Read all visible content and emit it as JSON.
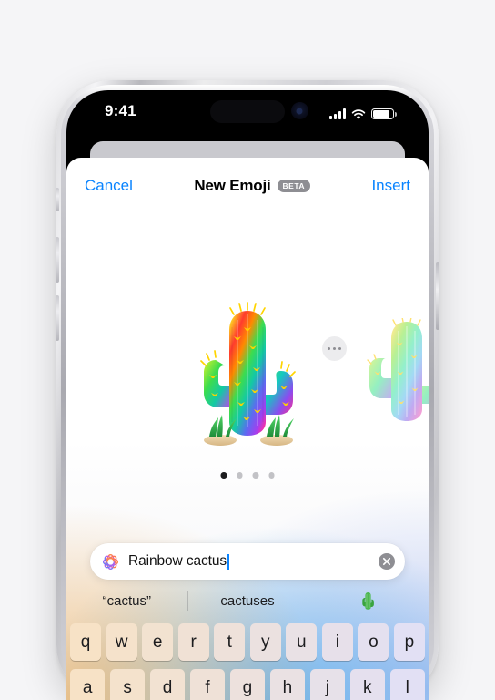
{
  "page": {
    "background_color": "#f5f5f7"
  },
  "device": {
    "name": "iphone-frame",
    "frame_color": "#d4d4d9",
    "buttons": [
      "mute-switch",
      "volume-up",
      "volume-down",
      "power-button"
    ]
  },
  "status_bar": {
    "time": "9:41",
    "cellular_icon": "signal-bars-icon",
    "wifi_icon": "wifi-icon",
    "battery_icon": "battery-icon",
    "dynamic_island": "dynamic-island",
    "front_camera": "front-camera"
  },
  "sheet": {
    "nav": {
      "cancel_label": "Cancel",
      "title": "New Emoji",
      "beta_label": "BETA",
      "insert_label": "Insert",
      "accent_color": "#0a84ff"
    },
    "canvas": {
      "more_button_icon": "ellipsis-icon",
      "main_emoji_name": "rainbow-cactus-emoji",
      "next_emoji_name": "pastel-cactus-emoji",
      "page_dots": {
        "count": 4,
        "active_index": 0
      }
    },
    "prompt": {
      "ai_icon": "apple-intelligence-icon",
      "value": "Rainbow cactus",
      "placeholder": "Describe an emoji",
      "clear_icon": "clear-circle-icon"
    },
    "predictions": [
      {
        "label": "“cactus”",
        "type": "text"
      },
      {
        "label": "cactuses",
        "type": "text"
      },
      {
        "label": "cactus-emoji",
        "type": "emoji"
      }
    ],
    "keyboard": {
      "row1": [
        "q",
        "w",
        "e",
        "r",
        "t",
        "y",
        "u",
        "i",
        "o",
        "p"
      ],
      "row2": [
        "a",
        "s",
        "d",
        "f",
        "g",
        "h",
        "j",
        "k",
        "l"
      ]
    }
  }
}
